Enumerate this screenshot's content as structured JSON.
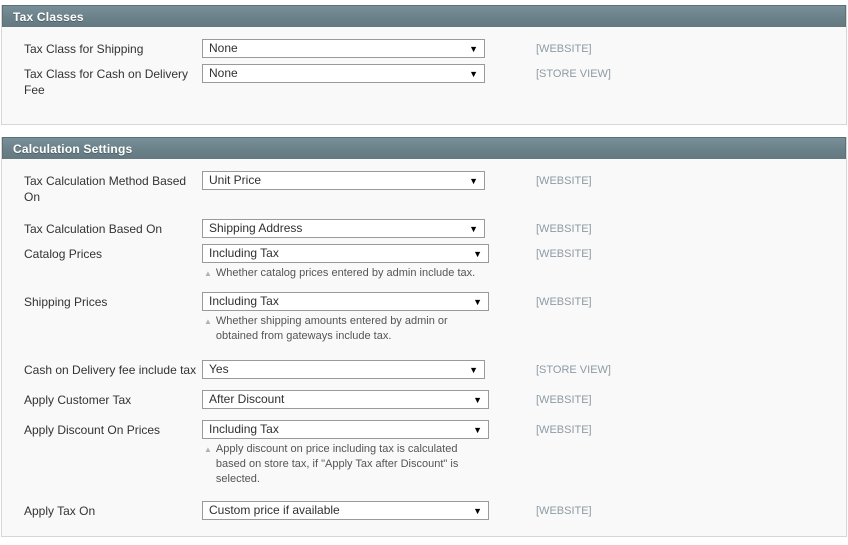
{
  "sections": [
    {
      "title": "Tax Classes",
      "rows": [
        {
          "label": "Tax Class for Shipping",
          "value": "None",
          "scope": "[WEBSITE]",
          "note": "",
          "width": "narrow"
        },
        {
          "label": "Tax Class for Cash on Delivery Fee",
          "value": "None",
          "scope": "[STORE VIEW]",
          "note": "",
          "width": "narrow"
        }
      ]
    },
    {
      "title": "Calculation Settings",
      "rows": [
        {
          "label": "Tax Calculation Method Based On",
          "value": "Unit Price",
          "scope": "[WEBSITE]",
          "note": "",
          "width": "narrow"
        },
        {
          "label": "Tax Calculation Based On",
          "value": "Shipping Address",
          "scope": "[WEBSITE]",
          "note": "",
          "width": "narrow"
        },
        {
          "label": "Catalog Prices",
          "value": "Including Tax",
          "scope": "[WEBSITE]",
          "note": "Whether catalog prices entered by admin include tax.",
          "width": "wide"
        },
        {
          "label": "Shipping Prices",
          "value": "Including Tax",
          "scope": "[WEBSITE]",
          "note": "Whether shipping amounts entered by admin or obtained from gateways include tax.",
          "width": "wide"
        },
        {
          "label": "Cash on Delivery fee include tax",
          "value": "Yes",
          "scope": "[STORE VIEW]",
          "note": "",
          "width": "narrow"
        },
        {
          "label": "Apply Customer Tax",
          "value": "After Discount",
          "scope": "[WEBSITE]",
          "note": "",
          "width": "narrow"
        },
        {
          "label": "Apply Discount On Prices",
          "value": "Including Tax",
          "scope": "[WEBSITE]",
          "note": "Apply discount on price including tax is calculated based on store tax, if \"Apply Tax after Discount\" is selected.",
          "width": "wide"
        },
        {
          "label": "Apply Tax On",
          "value": "Custom price if available",
          "scope": "[WEBSITE]",
          "note": "",
          "width": "narrow"
        }
      ]
    }
  ],
  "icons": {
    "dropdown_arrow": "▼",
    "note_marker": "▲"
  },
  "colors": {
    "header_bar": "#6b8189",
    "panel_bg": "#f9f9f9",
    "scope_text": "#8d9ba3",
    "border": "#d6d6d6"
  }
}
